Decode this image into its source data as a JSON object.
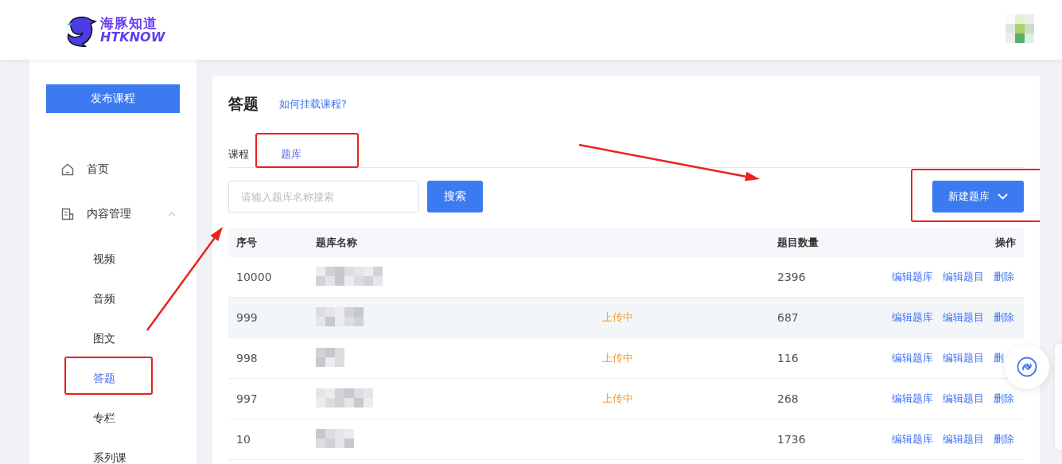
{
  "header": {
    "logo_title": "海豚知道",
    "logo_subtitle": "HTKNOW"
  },
  "sidebar": {
    "publish_button": "发布课程",
    "items": [
      {
        "label": "首页",
        "selected": false
      },
      {
        "label": "内容管理",
        "expanded": true,
        "selected": false,
        "children": [
          {
            "label": "视频",
            "selected": false,
            "highlighted": false
          },
          {
            "label": "音频",
            "selected": false,
            "highlighted": false
          },
          {
            "label": "图文",
            "selected": false,
            "highlighted": false
          },
          {
            "label": "答题",
            "selected": true,
            "highlighted": true
          },
          {
            "label": "专栏",
            "selected": false,
            "highlighted": false
          },
          {
            "label": "系列课",
            "selected": false,
            "highlighted": false
          }
        ]
      }
    ]
  },
  "page": {
    "title": "答题",
    "help_link": "如何挂载课程?",
    "tabs": [
      {
        "label": "课程",
        "selected": false,
        "highlighted": false
      },
      {
        "label": "题库",
        "selected": true,
        "highlighted": true
      }
    ],
    "search": {
      "placeholder": "请输入题库名称搜索",
      "button": "搜索"
    },
    "new_button": {
      "label": "新建题库",
      "highlighted": true
    },
    "table": {
      "columns": [
        "序号",
        "题库名称",
        "题目数量",
        "操作"
      ],
      "rows": [
        {
          "id": "10000",
          "name": {
            "kind": "redacted"
          },
          "status": "",
          "count": "2396",
          "actions": [
            "编辑题库",
            "编辑题目",
            "删除"
          ],
          "hovered": false
        },
        {
          "id": "999",
          "name": {
            "kind": "redacted"
          },
          "status": "上传中",
          "count": "687",
          "actions": [
            "编辑题库",
            "编辑题目",
            "删除"
          ],
          "hovered": true
        },
        {
          "id": "998",
          "name": {
            "kind": "redacted"
          },
          "status": "上传中",
          "count": "116",
          "actions": [
            "编辑题库",
            "编辑题目",
            "删"
          ],
          "hovered": false
        },
        {
          "id": "997",
          "name": {
            "kind": "redacted"
          },
          "status": "上传中",
          "count": "268",
          "actions": [
            "编辑题库",
            "编辑题目",
            "删除"
          ],
          "hovered": false
        },
        {
          "id": "10",
          "name": {
            "kind": "redacted"
          },
          "status": "",
          "count": "1736",
          "actions": [
            "编辑题库",
            "编辑题目",
            "删除"
          ],
          "hovered": false
        }
      ]
    }
  },
  "annotations": {
    "arrow_to_table": true,
    "arrow_to_new_button": true
  }
}
